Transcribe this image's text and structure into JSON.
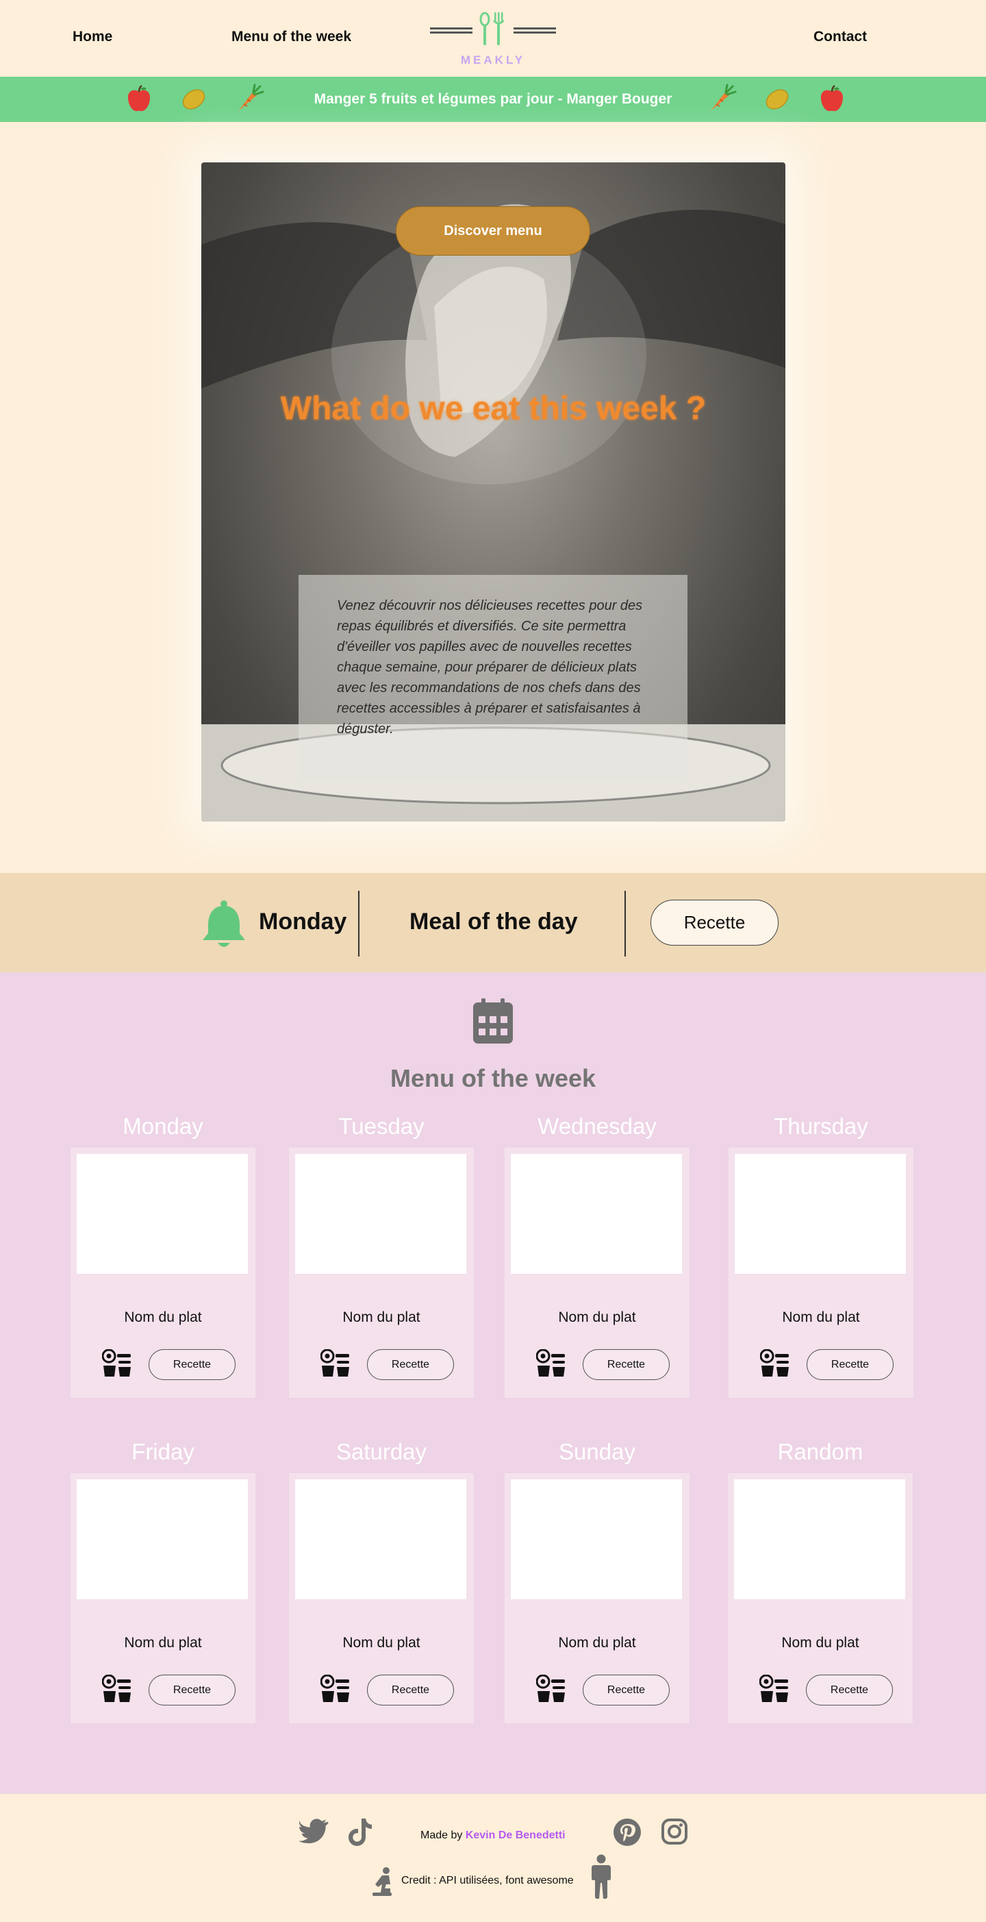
{
  "header": {
    "nav": {
      "home": "Home",
      "menu_of_week": "Menu of the week",
      "contact": "Contact"
    },
    "logo_text": "MEAKLY",
    "logo_icon": "fork-spoon-icon"
  },
  "banner": {
    "text": "Manger 5 fruits et légumes par jour - Manger Bouger",
    "icons": [
      "apple-icon",
      "lemon-icon",
      "carrot-icon",
      "carrot-icon",
      "lemon-icon",
      "apple-icon"
    ]
  },
  "hero": {
    "button_label": "Discover menu",
    "title": "What do we eat this week ?",
    "description": "Venez découvrir nos délicieuses recettes pour des repas équilibrés et diversifiés. Ce site permettra d'éveiller vos papilles avec de nouvelles recettes chaque semaine, pour préparer de délicieux plats avec les recommandations de nos chefs dans des recettes accessibles à préparer et satisfaisantes à déguster."
  },
  "today": {
    "icon": "bell-icon",
    "day": "Monday",
    "meal_label": "Meal of the day",
    "button_label": "Recette"
  },
  "menu": {
    "icon": "calendar-icon",
    "title": "Menu of the week",
    "days": [
      {
        "day": "Monday",
        "dish": "Nom du plat",
        "button": "Recette"
      },
      {
        "day": "Tuesday",
        "dish": "Nom du plat",
        "button": "Recette"
      },
      {
        "day": "Wednesday",
        "dish": "Nom du plat",
        "button": "Recette"
      },
      {
        "day": "Thursday",
        "dish": "Nom du plat",
        "button": "Recette"
      },
      {
        "day": "Friday",
        "dish": "Nom du plat",
        "button": "Recette"
      },
      {
        "day": "Saturday",
        "dish": "Nom du plat",
        "button": "Recette"
      },
      {
        "day": "Sunday",
        "dish": "Nom du plat",
        "button": "Recette"
      },
      {
        "day": "Random",
        "dish": "Nom du plat",
        "button": "Recette"
      }
    ]
  },
  "footer": {
    "made_by_prefix": "Made by ",
    "author": "Kevin De Benedetti",
    "credit": "Credit : API utilisées, font awesome",
    "social_icons": [
      "twitter-icon",
      "tiktok-icon",
      "pinterest-icon",
      "instagram-icon"
    ]
  },
  "colors": {
    "page_background": "#FDEFD9",
    "banner_green": "#71D38C",
    "hero_title_orange": "#F08A2E",
    "discover_button": "#C78F38",
    "today_bar": "#EFD9B7",
    "menu_background": "#EED4E6",
    "logo_purple": "#C8A6F0",
    "author_purple": "#B65BF0"
  }
}
